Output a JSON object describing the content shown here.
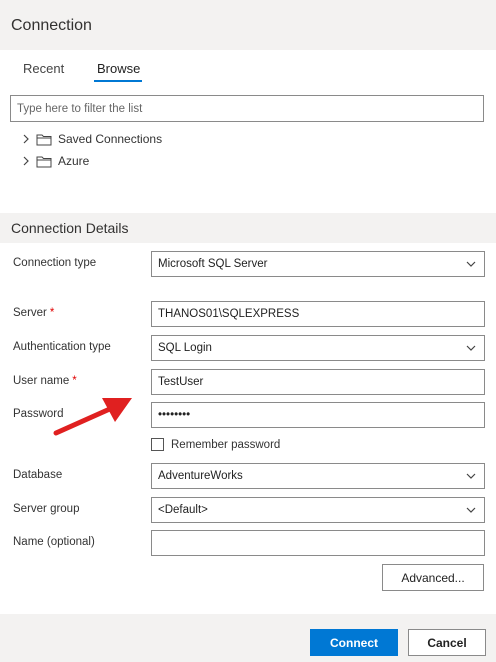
{
  "header": {
    "title": "Connection"
  },
  "tabs": [
    {
      "label": "Recent",
      "active": false
    },
    {
      "label": "Browse",
      "active": true
    }
  ],
  "filter": {
    "placeholder": "Type here to filter the list",
    "value": ""
  },
  "tree": [
    {
      "label": "Saved Connections",
      "icon": "folder-icon"
    },
    {
      "label": "Azure",
      "icon": "folder-icon"
    }
  ],
  "details": {
    "title": "Connection Details",
    "connection_type": {
      "label": "Connection type",
      "value": "Microsoft SQL Server"
    },
    "server": {
      "label": "Server",
      "required_mark": "*",
      "value": "THANOS01\\SQLEXPRESS"
    },
    "auth_type": {
      "label": "Authentication type",
      "value": "SQL Login"
    },
    "user_name": {
      "label": "User name",
      "required_mark": "*",
      "value": "TestUser"
    },
    "password": {
      "label": "Password",
      "value": "••••••••"
    },
    "remember_password": {
      "label": "Remember password",
      "checked": false
    },
    "database": {
      "label": "Database",
      "value": "AdventureWorks"
    },
    "server_group": {
      "label": "Server group",
      "value": "<Default>"
    },
    "name_optional": {
      "label": "Name (optional)",
      "value": ""
    }
  },
  "buttons": {
    "advanced": "Advanced...",
    "connect": "Connect",
    "cancel": "Cancel"
  },
  "colors": {
    "accent": "#0078d4",
    "annotation_arrow": "#e02020",
    "required": "#e00000"
  }
}
